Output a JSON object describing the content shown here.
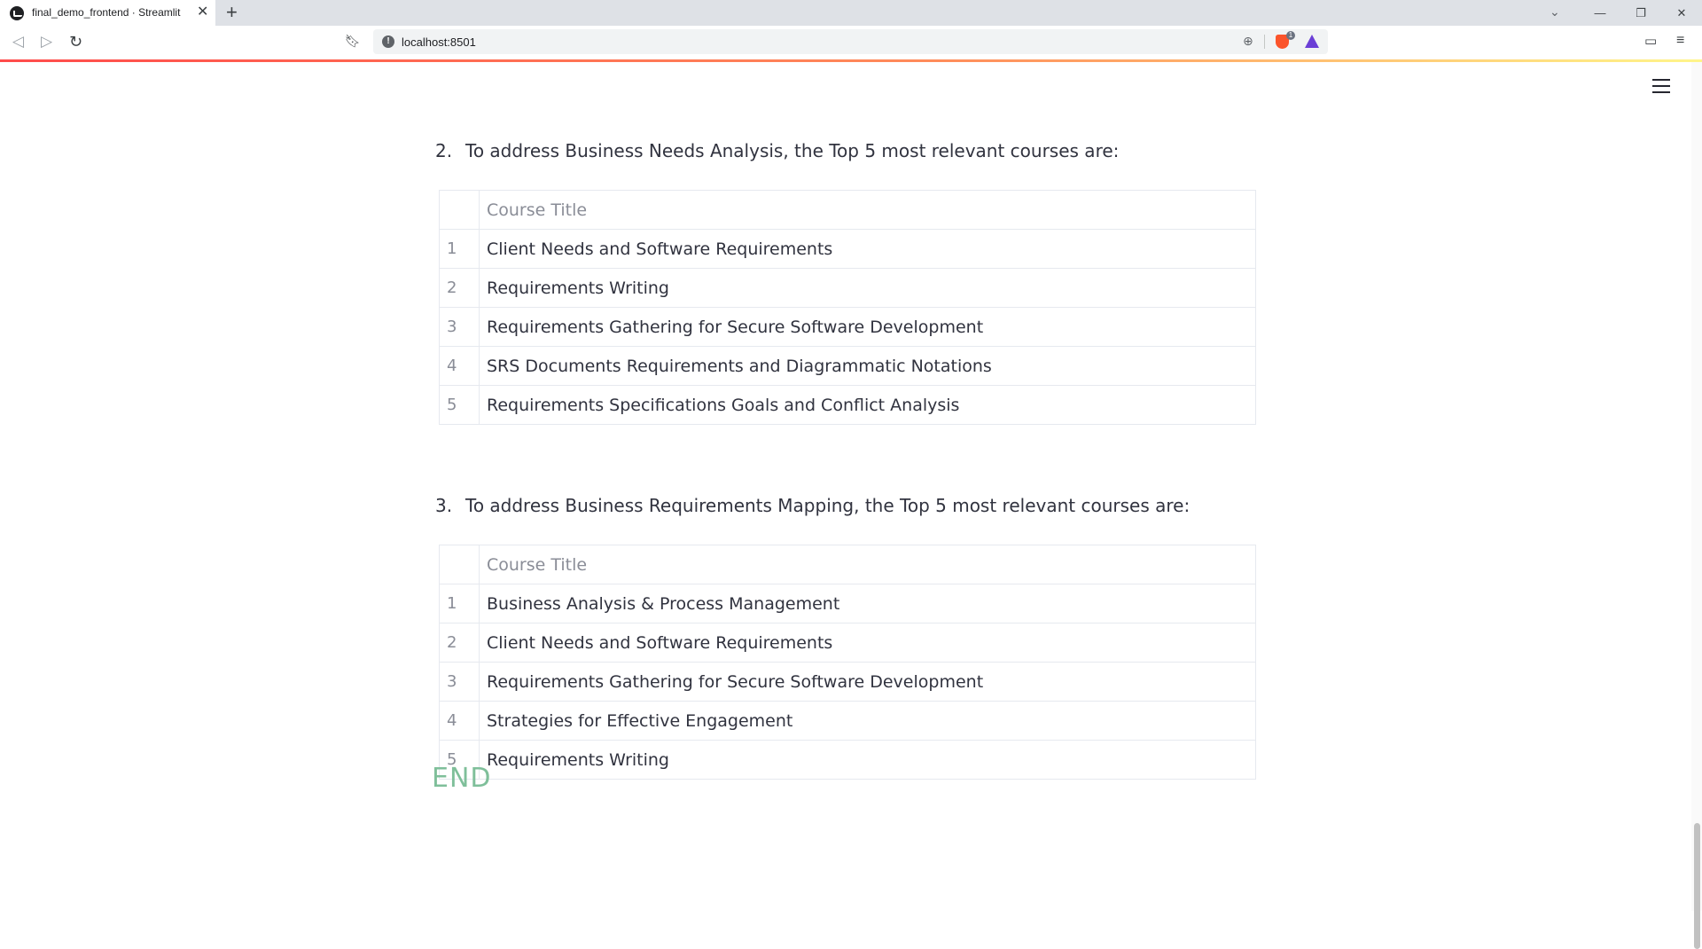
{
  "browser": {
    "tab_title": "final_demo_frontend · Streamlit",
    "tab_close": "✕",
    "new_tab": "+",
    "url": "localhost:8501",
    "shield_count": "1",
    "window_controls": {
      "tablist": "⌄",
      "minimize": "—",
      "restore": "❐",
      "close": "✕"
    }
  },
  "sections": [
    {
      "number": "2.",
      "heading": "To address Business Needs Analysis, the Top 5 most relevant courses are:",
      "column_header": "Course Title",
      "rows": [
        {
          "index": "1",
          "title": "Client Needs and Software Requirements"
        },
        {
          "index": "2",
          "title": "Requirements Writing"
        },
        {
          "index": "3",
          "title": "Requirements Gathering for Secure Software Development"
        },
        {
          "index": "4",
          "title": "SRS Documents Requirements and Diagrammatic Notations"
        },
        {
          "index": "5",
          "title": "Requirements Specifications Goals and Conflict Analysis"
        }
      ]
    },
    {
      "number": "3.",
      "heading": "To address Business Requirements Mapping, the Top 5 most relevant courses are:",
      "column_header": "Course Title",
      "rows": [
        {
          "index": "1",
          "title": "Business Analysis & Process Management"
        },
        {
          "index": "2",
          "title": "Client Needs and Software Requirements"
        },
        {
          "index": "3",
          "title": "Requirements Gathering for Secure Software Development"
        },
        {
          "index": "4",
          "title": "Strategies for Effective Engagement"
        },
        {
          "index": "5",
          "title": "Requirements Writing"
        }
      ]
    }
  ],
  "end_text": "END",
  "colors": {
    "accent_green": "#7fbf9a",
    "text": "#31333f",
    "muted": "#8a8d97"
  }
}
